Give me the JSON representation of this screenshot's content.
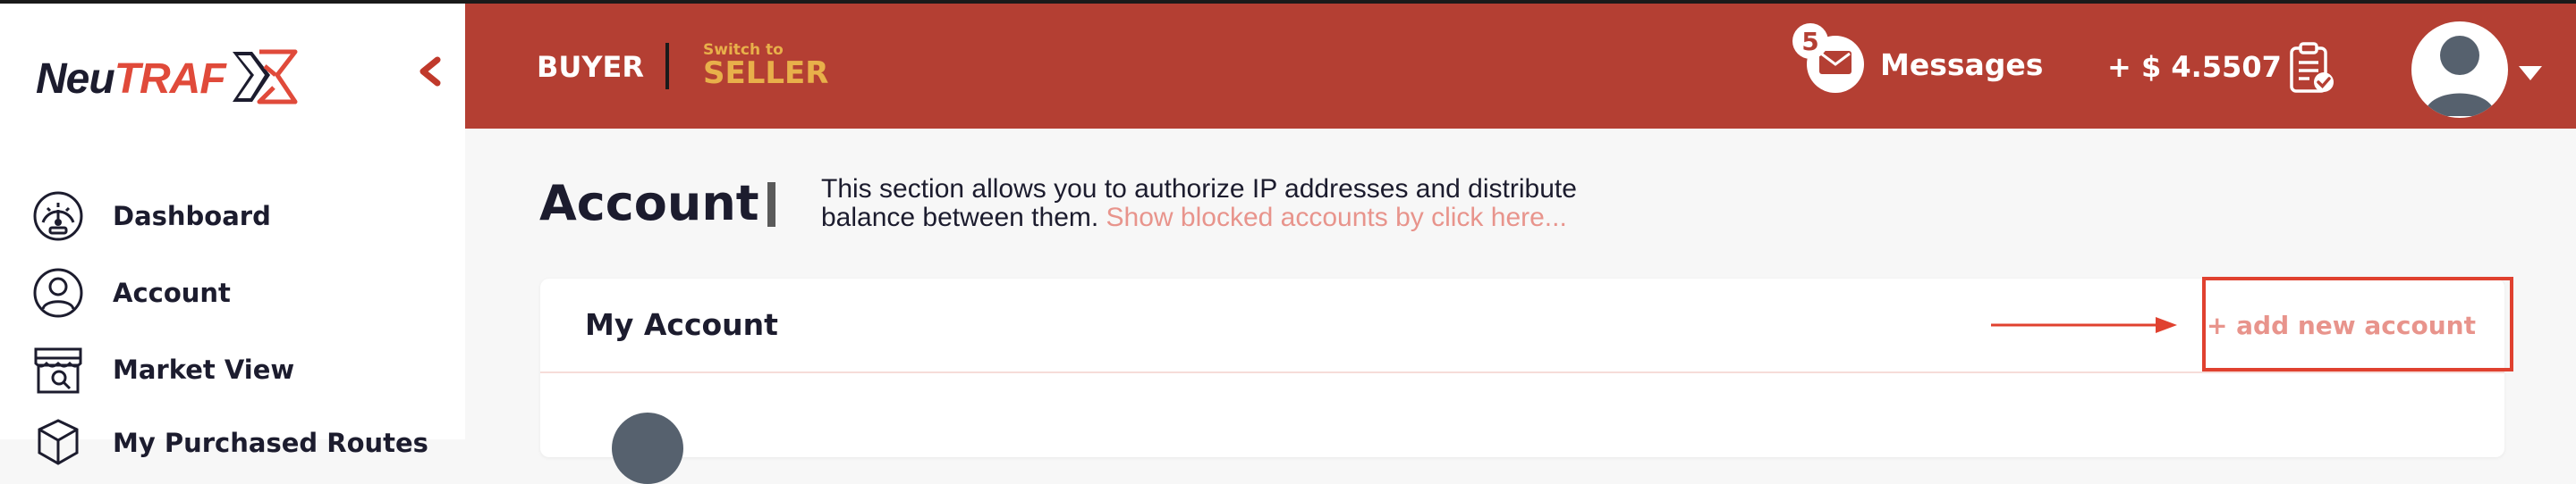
{
  "brand": {
    "name_part1": "Neu",
    "name_part2": "TRAF",
    "accent": "#e04a3a"
  },
  "sidebar": {
    "collapse_icon": "chevron-left-icon",
    "items": [
      {
        "label": "Dashboard",
        "icon": "speedometer-icon"
      },
      {
        "label": "Account",
        "icon": "user-circle-icon"
      },
      {
        "label": "Market View",
        "icon": "storefront-icon"
      },
      {
        "label": "My Purchased Routes",
        "icon": "box-icon"
      }
    ]
  },
  "header": {
    "background": "#b43f33",
    "role": "BUYER",
    "switch_small": "Switch to",
    "switch_big": "SELLER",
    "messages": {
      "label": "Messages",
      "count": "5"
    },
    "balance": "+ $ 4.5507"
  },
  "main": {
    "title": "Account",
    "description_line1": "This section allows you to authorize IP addresses and distribute",
    "description_line2": "balance between them. ",
    "description_link": "Show blocked accounts by click here...",
    "card": {
      "title": "My Account",
      "add_label": "+ add new account"
    }
  }
}
